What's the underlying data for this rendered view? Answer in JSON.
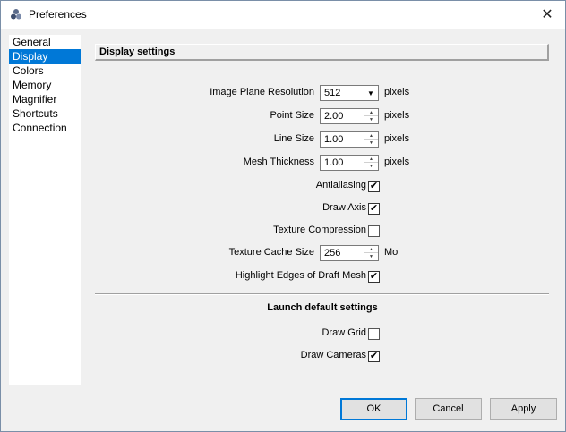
{
  "window": {
    "title": "Preferences",
    "close_glyph": "✕"
  },
  "sidebar": {
    "items": [
      {
        "label": "General"
      },
      {
        "label": "Display"
      },
      {
        "label": "Colors"
      },
      {
        "label": "Memory"
      },
      {
        "label": "Magnifier"
      },
      {
        "label": "Shortcuts"
      },
      {
        "label": "Connection"
      }
    ],
    "selected": "Display"
  },
  "display": {
    "header": "Display settings",
    "image_plane_resolution": {
      "label": "Image Plane Resolution",
      "value": "512",
      "unit": "pixels"
    },
    "point_size": {
      "label": "Point Size",
      "value": "2.00",
      "unit": "pixels"
    },
    "line_size": {
      "label": "Line Size",
      "value": "1.00",
      "unit": "pixels"
    },
    "mesh_thickness": {
      "label": "Mesh Thickness",
      "value": "1.00",
      "unit": "pixels"
    },
    "antialiasing": {
      "label": "Antialiasing",
      "checked": true
    },
    "draw_axis": {
      "label": "Draw Axis",
      "checked": true
    },
    "texture_compression": {
      "label": "Texture Compression",
      "checked": false
    },
    "texture_cache_size": {
      "label": "Texture Cache Size",
      "value": "256",
      "unit": "Mo"
    },
    "highlight_edges": {
      "label": "Highlight Edges of Draft Mesh",
      "checked": true
    }
  },
  "launch": {
    "header": "Launch default settings",
    "draw_grid": {
      "label": "Draw Grid",
      "checked": false
    },
    "draw_cameras": {
      "label": "Draw Cameras",
      "checked": true
    }
  },
  "buttons": {
    "ok": "OK",
    "cancel": "Cancel",
    "apply": "Apply"
  },
  "check_glyph": "✔",
  "colors": {
    "selection": "#0078d7",
    "default_button_border": "#0078d7"
  }
}
